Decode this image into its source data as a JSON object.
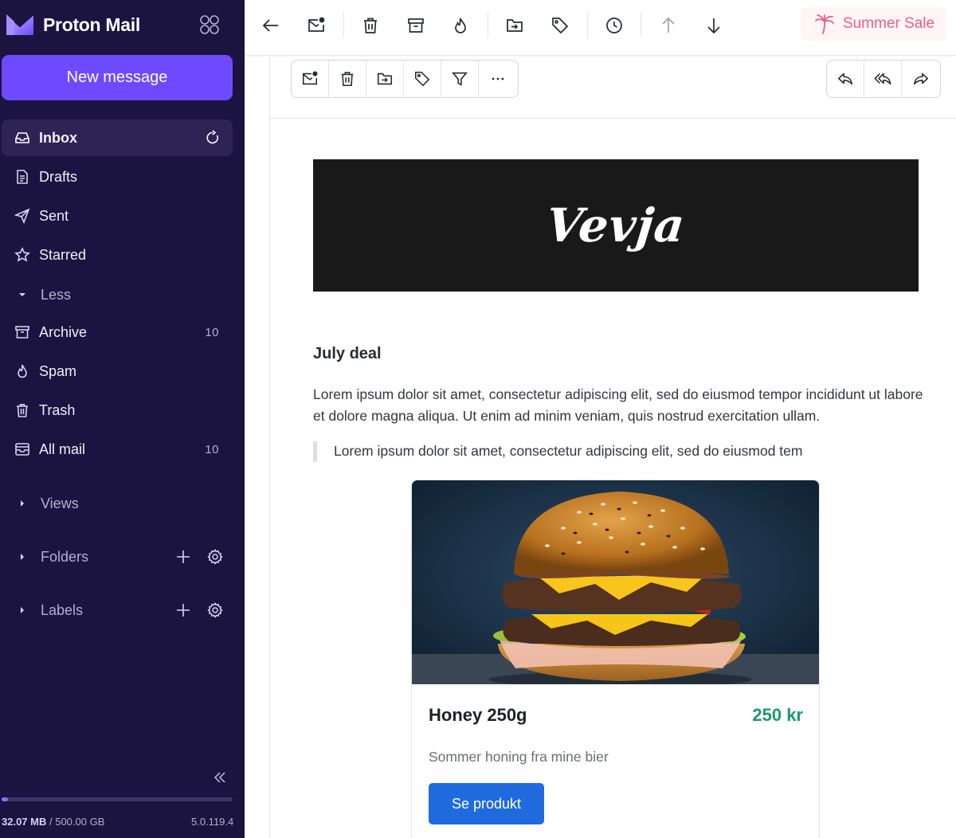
{
  "sidebar": {
    "brand_name": "Proton Mail",
    "new_message_label": "New message",
    "items": [
      {
        "label": "Inbox",
        "count": ""
      },
      {
        "label": "Drafts",
        "count": ""
      },
      {
        "label": "Sent",
        "count": ""
      },
      {
        "label": "Starred",
        "count": ""
      },
      {
        "label": "Less",
        "count": ""
      },
      {
        "label": "Archive",
        "count": "10"
      },
      {
        "label": "Spam",
        "count": ""
      },
      {
        "label": "Trash",
        "count": ""
      },
      {
        "label": "All mail",
        "count": "10"
      }
    ],
    "sections": [
      {
        "label": "Views"
      },
      {
        "label": "Folders"
      },
      {
        "label": "Labels"
      }
    ],
    "storage_used": "32.07 MB",
    "storage_total": " / 500.00 GB",
    "storage_fraction": 6e-05,
    "version": "5.0.119.4"
  },
  "topbar": {
    "promo_label": "Summer Sale",
    "accent": "#ea5f86"
  },
  "email": {
    "brand_logo_text": "Vevja",
    "title": "July deal",
    "paragraph": "Lorem ipsum dolor sit amet, consectetur adipiscing elit, sed do eiusmod tempor incididunt ut labore et dolore magna aliqua. Ut enim ad minim veniam, quis nostrud exercitation ullam.",
    "quote": "Lorem ipsum dolor sit amet, consectetur adipiscing elit, sed do eiusmod tem",
    "product": {
      "name": "Honey 250g",
      "price": "250 kr",
      "description": "Sommer honing fra mine bier",
      "button_label": "Se produkt"
    }
  },
  "colors": {
    "sidebar_bg": "#1b1340",
    "primary": "#6d4aff",
    "price_green": "#1a9a6c",
    "cta_blue": "#1f6bde"
  }
}
